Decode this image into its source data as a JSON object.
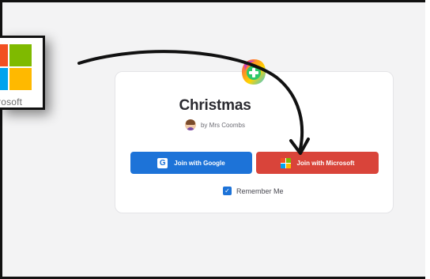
{
  "quiz": {
    "title": "Christmas",
    "author": "by Mrs Coombs"
  },
  "buttons": {
    "google_label": "Join with Google",
    "microsoft_label": "Join with Microsoft",
    "google_icon_glyph": "G"
  },
  "remember": {
    "label": "Remember Me",
    "checked": true,
    "check_glyph": "✓"
  },
  "inset": {
    "caption": "rosoft"
  },
  "colors": {
    "google_blue": "#1d73d8",
    "microsoft_red": "#d9443a",
    "ms_logo": [
      "#f25022",
      "#7fba00",
      "#00a4ef",
      "#ffb900"
    ]
  },
  "icons": {
    "google": "google-icon",
    "microsoft": "microsoft-icon",
    "checkbox": "checkbox-checked-icon",
    "logo": "flippity-plus-logo",
    "annotation": "curved-arrow-icon"
  }
}
